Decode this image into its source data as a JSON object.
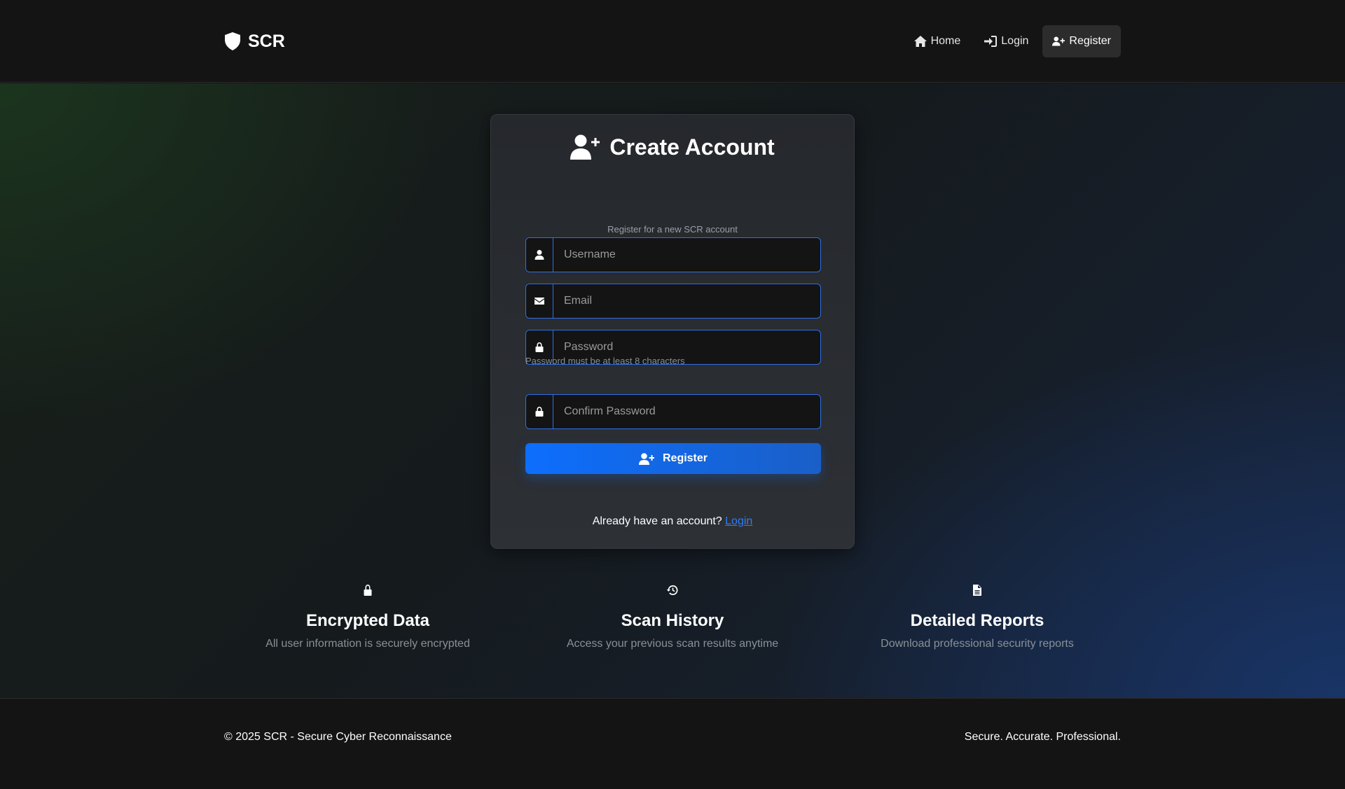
{
  "navbar": {
    "brand": "SCR",
    "links": [
      {
        "label": "Home",
        "icon": "home-icon"
      },
      {
        "label": "Login",
        "icon": "sign-in-icon"
      },
      {
        "label": "Register",
        "icon": "user-plus-icon",
        "active": true
      }
    ]
  },
  "card": {
    "title": "Create Account",
    "subtitle": "Register for a new SCR account",
    "fields": {
      "username": {
        "placeholder": "Username",
        "value": ""
      },
      "email": {
        "placeholder": "Email",
        "value": ""
      },
      "password": {
        "placeholder": "Password",
        "value": ""
      },
      "confirm_password": {
        "placeholder": "Confirm Password",
        "value": ""
      }
    },
    "password_hint": "Password must be at least 8 characters",
    "register_label": "Register",
    "login_prompt": "Already have an account?",
    "login_link": "Login"
  },
  "features": [
    {
      "icon": "lock-icon",
      "title": "Encrypted Data",
      "description": "All user information is securely encrypted"
    },
    {
      "icon": "history-icon",
      "title": "Scan History",
      "description": "Access your previous scan results anytime"
    },
    {
      "icon": "file-icon",
      "title": "Detailed Reports",
      "description": "Download professional security reports"
    }
  ],
  "footer": {
    "copyright": "© 2025 SCR - Secure Cyber Reconnaissance",
    "tagline": "Secure. Accurate. Professional."
  },
  "colors": {
    "accent": "#0d6efd",
    "input_border": "#2f6fe8",
    "link": "#2f7cf6",
    "background": "#141414"
  }
}
